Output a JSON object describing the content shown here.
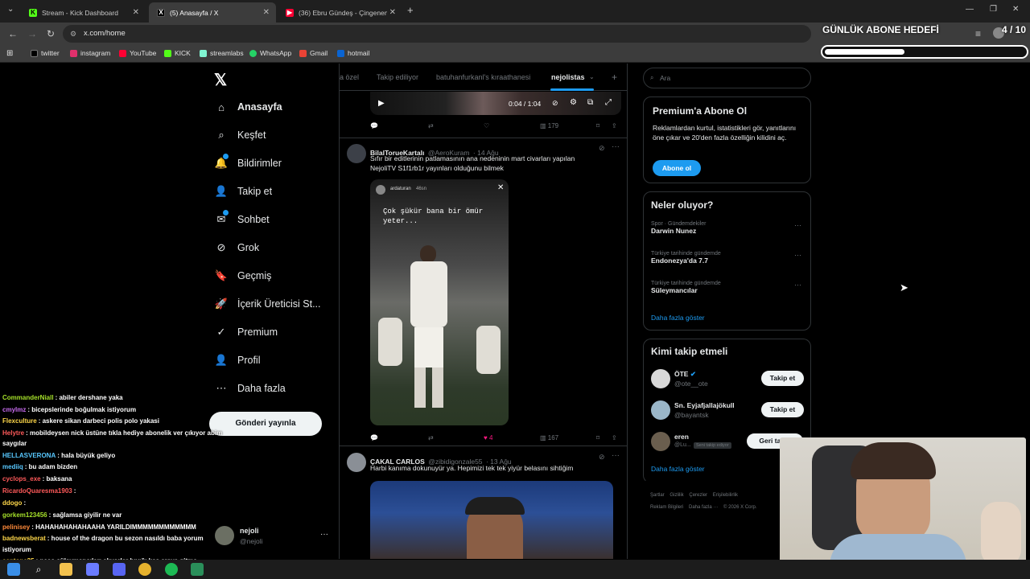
{
  "browser": {
    "tabs": [
      {
        "title": "Stream - Kick Dashboard",
        "icon": "kick-icon",
        "active": false
      },
      {
        "title": "(5) Anasayfa / X",
        "icon": "x-icon",
        "active": true
      },
      {
        "title": "(36) Ebru Gündeş - Çingenem (",
        "icon": "youtube-icon",
        "active": false
      }
    ],
    "url": "x.com/home",
    "bookmarks": [
      "twitter",
      "instagram",
      "YouTube",
      "KICK",
      "streamlabs",
      "WhatsApp",
      "Gmail",
      "hotmail"
    ]
  },
  "x": {
    "nav": [
      {
        "label": "Anasayfa",
        "icon": "home-icon"
      },
      {
        "label": "Keşfet",
        "icon": "search-icon"
      },
      {
        "label": "Bildirimler",
        "icon": "bell-icon"
      },
      {
        "label": "Takip et",
        "icon": "follow-icon"
      },
      {
        "label": "Sohbet",
        "icon": "chat-icon"
      },
      {
        "label": "Grok",
        "icon": "grok-icon"
      },
      {
        "label": "Geçmiş",
        "icon": "bookmark-icon"
      },
      {
        "label": "İçerik Üreticisi St...",
        "icon": "rocket-icon"
      },
      {
        "label": "Premium",
        "icon": "premium-icon"
      },
      {
        "label": "Profil",
        "icon": "profile-icon"
      },
      {
        "label": "Daha fazla",
        "icon": "more-icon"
      }
    ],
    "post_button": "Gönderi yayınla",
    "account": {
      "name": "nejoli",
      "handle": "@nejoli"
    },
    "feed_tabs": [
      "a özel",
      "Takip ediliyor",
      "batuhanfurkanl's kıraathanesi",
      "nejolistas"
    ],
    "video": {
      "time": "0:04 / 1:04",
      "views": "179"
    },
    "tweets": [
      {
        "name": "BilalToruеKartalı",
        "handle": "@AeroKuram",
        "date": "· 14 Ağu",
        "text_line1": "Sıfır bir editlerinin patlamasının ana nedeninin mart civarları yapılan",
        "text_line2": "NejoliTV S1f1rb1r yayınları olduğunu bilmek",
        "image_caption_line1": "Çok şükür bana bir ömür",
        "image_caption_line2": "yeter...",
        "image_user": "ardaturan",
        "image_time": "46sn",
        "likes": "4",
        "views": "167"
      },
      {
        "name": "ÇAKAL CARLOS",
        "handle": "@zibidigonzale55",
        "date": "· 13 Ağu",
        "text_line1": "Harbi kanıma dokunuyür ya. Hepimizi tek tek yiyür belasını sihtiğim"
      }
    ]
  },
  "sidebar": {
    "search_placeholder": "Ara",
    "premium": {
      "title": "Premium'a Abone Ol",
      "text": "Reklamlardan kurtul, istatistikleri gör, yanıtlarını öne çıkar ve 20'den fazla özelliğin kilidini aç.",
      "button": "Abone ol"
    },
    "trends_title": "Neler oluyor?",
    "trends": [
      {
        "context": "Spor · Gündemdekiler",
        "name": "Darwin Nunez"
      },
      {
        "context": "Türkiye tarihinde gündemde",
        "name": "Endonezya'da 7.7"
      },
      {
        "context": "Türkiye tarihinde gündemde",
        "name": "Süleymancılar"
      }
    ],
    "show_more": "Daha fazla göster",
    "who_title": "Kimi takip etmeli",
    "who": [
      {
        "name": "ÖTE",
        "handle": "@ote__ote",
        "button": "Takip et"
      },
      {
        "name": "Sn. Eyjafjallajökull",
        "handle": "@bayantsk",
        "button": "Takip et"
      },
      {
        "name": "eren",
        "handle": "@Lu...",
        "tag": "Seni takip ediyor",
        "button": "Geri takip"
      }
    ],
    "show_more2": "Daha fazla göster",
    "footer_line1": [
      "Şartlar",
      "Gizlilik",
      "Çerezler",
      "Erişilebilirlik"
    ],
    "footer_line2": [
      "Reklam Bilgileri",
      "Daha fazla ···",
      "© 2026 X Corp."
    ]
  },
  "overlay": {
    "goal_title": "GÜNLÜK ABONE HEDEFİ",
    "goal_count": "4 / 10",
    "goal_progress": 0.4
  },
  "chat": [
    {
      "user": "CommanderNiall",
      "msg": ": abiler dershane yaka",
      "color": "#a5e02a"
    },
    {
      "user": "cmylmz",
      "msg": ": bicepslerinde boğulmak istiyorum",
      "color": "#c86cf0"
    },
    {
      "user": "Flexculture",
      "msg": ": askere sikan darbeci polis polo yakasi",
      "color": "#ffd84a"
    },
    {
      "user": "Helytre",
      "msg": ": mobildeysen nick üstüne tıkla hediye abonelik ver çıkıyor abim",
      "color": "#ff5a5a"
    },
    {
      "user": "",
      "msg": "saygılar",
      "color": "#fff"
    },
    {
      "user": "HELLASVERONA",
      "msg": ": hala büyük geliyo",
      "color": "#58c8ff"
    },
    {
      "user": "mediiq",
      "msg": ": bu adam bizden",
      "color": "#58c8ff"
    },
    {
      "user": "cyclops_exe",
      "msg": ": baksana",
      "color": "#ff5a5a"
    },
    {
      "user": "RicardoQuaresma1903",
      "msg": ":",
      "color": "#ff5a5a"
    },
    {
      "user": "ddogo",
      "msg": ":",
      "color": "#ffd84a"
    },
    {
      "user": "gorkem123456",
      "msg": ": sağlamsa giyilir ne var",
      "color": "#a5e02a"
    },
    {
      "user": "pelinisey",
      "msg": ": HAHAHAHAHAHAAHA YARILDIMMMMMMMMMMMM",
      "color": "#ff8a3a"
    },
    {
      "user": "badnewsberat",
      "msg": ": house of the dragon bu sezon nasıldı baba yorum",
      "color": "#ffd84a"
    },
    {
      "user": "",
      "msg": "istiyorum",
      "color": "#fff"
    },
    {
      "user": "cantona35",
      "msg": ": neco süleymancıları alıyorlar bıyığı kes araya gitme",
      "color": "#ffd84a"
    }
  ]
}
